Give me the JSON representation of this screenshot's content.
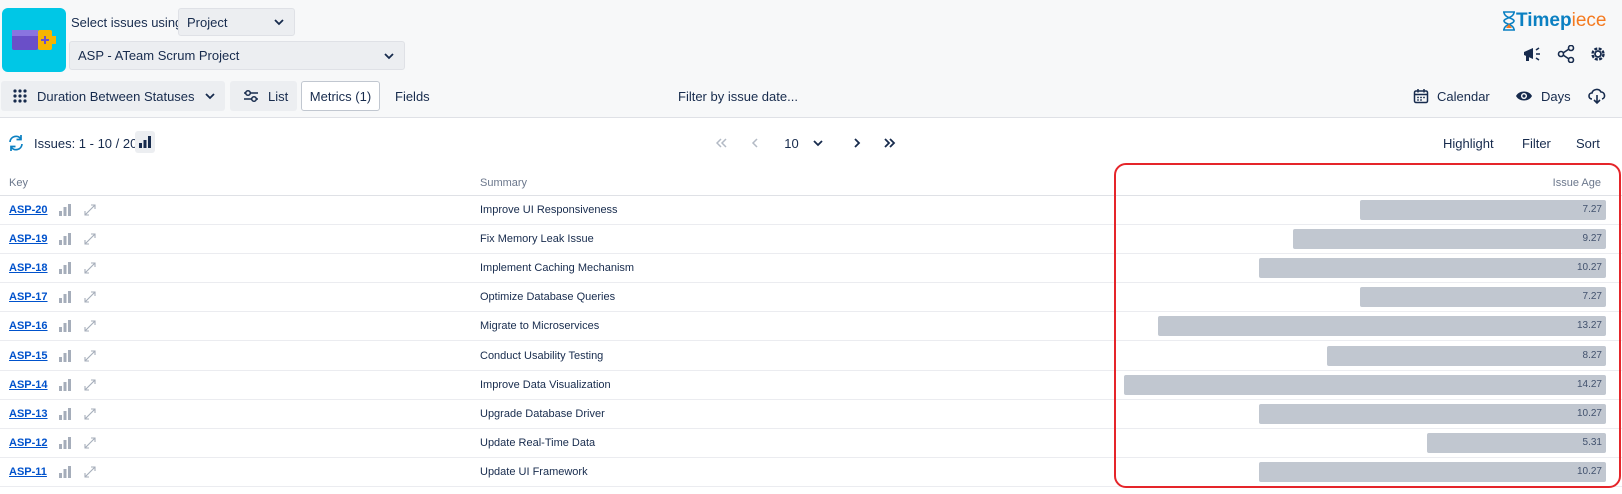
{
  "header": {
    "select_label": "Select issues using",
    "select_mode": "Project",
    "project": "ASP - ATeam Scrum Project",
    "brand_part1": "Timep",
    "brand_part2": "iece"
  },
  "toolbar": {
    "report_type": "Duration Between Statuses",
    "list_label": "List",
    "metrics_label": "Metrics (1)",
    "fields_label": "Fields",
    "filter_date_label": "Filter by issue date...",
    "calendar_label": "Calendar",
    "days_label": "Days"
  },
  "issues_bar": {
    "count": "Issues: 1 - 10 / 20",
    "page_size": "10",
    "highlight_label": "Highlight",
    "filter_label": "Filter",
    "sort_label": "Sort"
  },
  "table": {
    "columns": {
      "key": "Key",
      "summary": "Summary",
      "issue_age": "Issue Age"
    },
    "max_value": 14.27,
    "rows": [
      {
        "key": "ASP-20",
        "summary": "Improve UI Responsiveness",
        "age": "7.27"
      },
      {
        "key": "ASP-19",
        "summary": "Fix Memory Leak Issue",
        "age": "9.27"
      },
      {
        "key": "ASP-18",
        "summary": "Implement Caching Mechanism",
        "age": "10.27"
      },
      {
        "key": "ASP-17",
        "summary": "Optimize Database Queries",
        "age": "7.27"
      },
      {
        "key": "ASP-16",
        "summary": "Migrate to Microservices",
        "age": "13.27"
      },
      {
        "key": "ASP-15",
        "summary": "Conduct Usability Testing",
        "age": "8.27"
      },
      {
        "key": "ASP-14",
        "summary": "Improve Data Visualization",
        "age": "14.27"
      },
      {
        "key": "ASP-13",
        "summary": "Upgrade Database Driver",
        "age": "10.27"
      },
      {
        "key": "ASP-12",
        "summary": "Update Real-Time Data",
        "age": "5.31"
      },
      {
        "key": "ASP-11",
        "summary": "Update UI Framework",
        "age": "10.27"
      }
    ]
  },
  "colors": {
    "accent_cyan": "#00c7e6",
    "link_blue": "#0052cc",
    "bar_gray": "#c1c7d0",
    "highlight_red": "#e5252a"
  }
}
